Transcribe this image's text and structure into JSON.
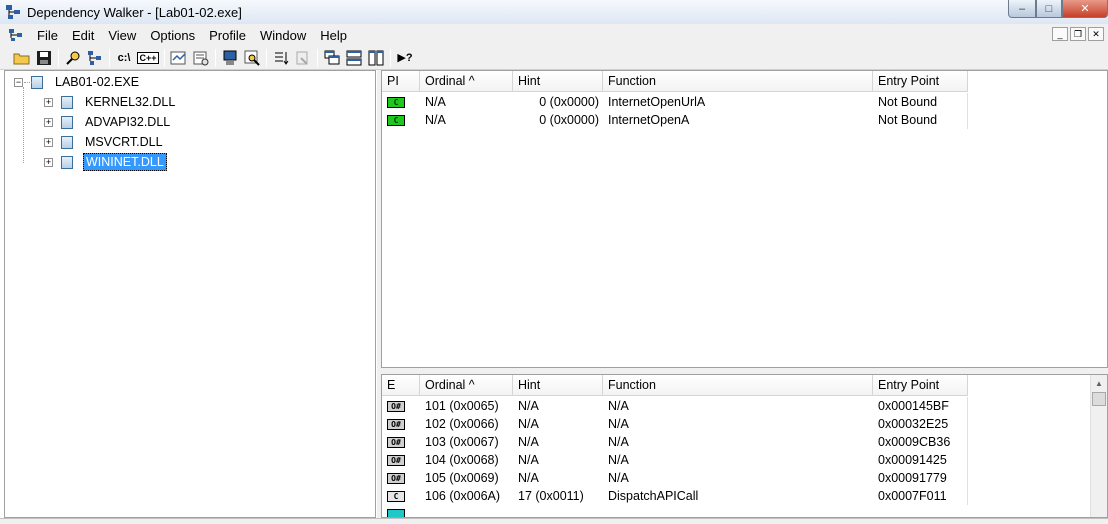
{
  "window": {
    "title": "Dependency Walker - [Lab01-02.exe]",
    "controls": {
      "minimize": "–",
      "maximize": "□",
      "close": "✕"
    }
  },
  "menu": {
    "items": [
      "File",
      "Edit",
      "View",
      "Options",
      "Profile",
      "Window",
      "Help"
    ],
    "mdi_controls": [
      "_",
      "❐",
      "✕"
    ]
  },
  "toolbar": {
    "buttons": [
      {
        "name": "open-icon",
        "glyph": "📂"
      },
      {
        "name": "save-icon",
        "glyph": "💾"
      },
      {
        "name": "find-icon",
        "glyph": "🔎"
      },
      {
        "name": "copy-path-icon",
        "glyph": "⎘"
      },
      {
        "name": "full-paths-icon",
        "text": "c:\\"
      },
      {
        "name": "undecorate-cpp-icon",
        "text": "C++"
      },
      {
        "name": "auto-expand-icon",
        "glyph": "⇲"
      },
      {
        "name": "properties-icon",
        "glyph": "▤"
      },
      {
        "name": "system-info-icon",
        "glyph": "▣"
      },
      {
        "name": "view-module-icon",
        "glyph": "⌕"
      },
      {
        "name": "sort-icon",
        "glyph": "⇅"
      },
      {
        "name": "configure-icon",
        "glyph": "⚙"
      },
      {
        "name": "cascade-icon",
        "glyph": "⧉"
      },
      {
        "name": "tile-horizontal-icon",
        "glyph": "☰"
      },
      {
        "name": "tile-vertical-icon",
        "glyph": "◫"
      },
      {
        "name": "context-help-icon",
        "text": "▶?"
      }
    ]
  },
  "tree": {
    "root": "LAB01-02.EXE",
    "children": [
      "KERNEL32.DLL",
      "ADVAPI32.DLL",
      "MSVCRT.DLL",
      "WININET.DLL"
    ],
    "selected": "WININET.DLL",
    "collapse_sign": "−",
    "expand_sign": "+"
  },
  "imports": {
    "columns": [
      "PI",
      "Ordinal ^",
      "Hint",
      "Function",
      "Entry Point"
    ],
    "rows": [
      {
        "badge": "C",
        "ordinal": "N/A",
        "hint": "0 (0x0000)",
        "function": "InternetOpenUrlA",
        "entry": "Not Bound"
      },
      {
        "badge": "C",
        "ordinal": "N/A",
        "hint": "0 (0x0000)",
        "function": "InternetOpenA",
        "entry": "Not Bound"
      }
    ]
  },
  "exports": {
    "columns": [
      "E",
      "Ordinal ^",
      "Hint",
      "Function",
      "Entry Point"
    ],
    "rows": [
      {
        "badge": "O#",
        "ordinal": "101 (0x0065)",
        "hint": "N/A",
        "function": "N/A",
        "entry": "0x000145BF"
      },
      {
        "badge": "O#",
        "ordinal": "102 (0x0066)",
        "hint": "N/A",
        "function": "N/A",
        "entry": "0x00032E25"
      },
      {
        "badge": "O#",
        "ordinal": "103 (0x0067)",
        "hint": "N/A",
        "function": "N/A",
        "entry": "0x0009CB36"
      },
      {
        "badge": "O#",
        "ordinal": "104 (0x0068)",
        "hint": "N/A",
        "function": "N/A",
        "entry": "0x00091425"
      },
      {
        "badge": "O#",
        "ordinal": "105 (0x0069)",
        "hint": "N/A",
        "function": "N/A",
        "entry": "0x00091779"
      },
      {
        "badge": "C",
        "ordinal": "106 (0x006A)",
        "hint": "17 (0x0011)",
        "function": "DispatchAPICall",
        "entry": "0x0007F011"
      }
    ],
    "scroll_up": "▲"
  }
}
